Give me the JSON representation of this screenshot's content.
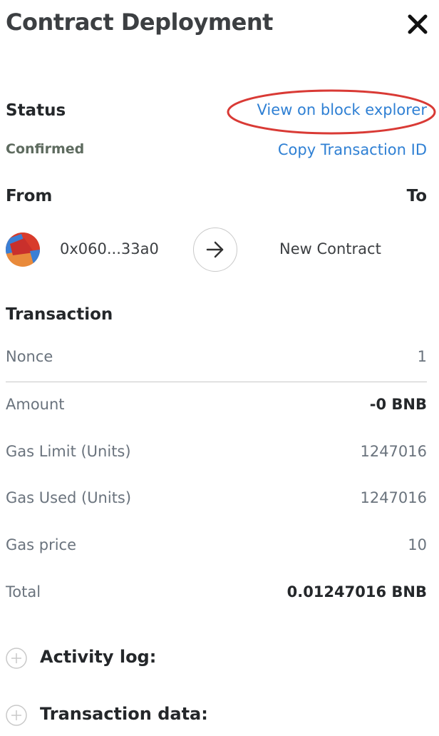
{
  "header": {
    "title": "Contract Deployment",
    "close_icon": "close-icon"
  },
  "status": {
    "label": "Status",
    "value": "Confirmed",
    "view_explorer_link": "View on block explorer",
    "copy_tx_link": "Copy Transaction ID",
    "value_color": "#5e6b5f",
    "link_color": "#2f80d4",
    "highlight_color": "#d93a35"
  },
  "transfer": {
    "from_label": "From",
    "to_label": "To",
    "from_address": "0x060...33a0",
    "to_address": "New Contract",
    "arrow_icon": "arrow-right-icon",
    "avatar_icon": "jazzicon-avatar"
  },
  "transaction": {
    "heading": "Transaction",
    "rows": [
      {
        "label": "Nonce",
        "value": "1"
      },
      {
        "label": "Amount",
        "value": "-0 BNB"
      },
      {
        "label": "Gas Limit (Units)",
        "value": "1247016"
      },
      {
        "label": "Gas Used (Units)",
        "value": "1247016"
      },
      {
        "label": "Gas price",
        "value": "10"
      },
      {
        "label": "Total",
        "value": "0.01247016 BNB"
      }
    ]
  },
  "sections": {
    "activity_log": "Activity log:",
    "transaction_data": "Transaction data:",
    "expand_icon": "plus-circle-icon"
  }
}
